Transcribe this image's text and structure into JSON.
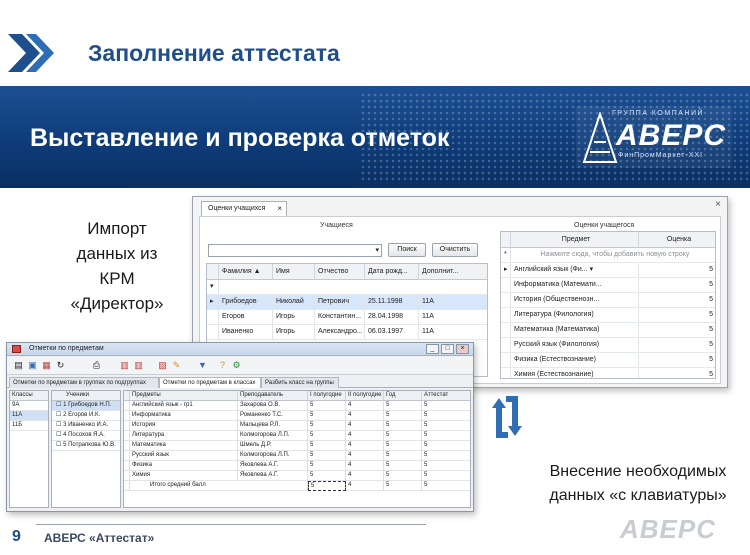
{
  "slide": {
    "title": "Заполнение аттестата",
    "banner_title": "Выставление и проверка отметок",
    "logo": {
      "top": "ГРУППА КОМПАНИЙ",
      "name": "АВЕРС",
      "sub": "ФинПромМаркет-XXI"
    },
    "import_text": [
      "Импорт",
      "данных из",
      "КРМ",
      "«Директор»"
    ],
    "keyboard_text": [
      "Внесение необходимых",
      "данных  «с клавиатуры»"
    ],
    "page_number": "9",
    "footer_text": "АВЕРС «Аттестат»",
    "footer_logo": "АВЕРС"
  },
  "window1": {
    "tab_label": "Оценки учащихся",
    "students_group": "Учащиеся",
    "grades_group": "Оценки учащегося",
    "search_button": "Поиск",
    "clear_button": "Очистить",
    "students_columns": [
      "Фамилия",
      "Имя",
      "Отчество",
      "Дата рожд...",
      "Дополнит..."
    ],
    "students": [
      [
        "Грибоедов",
        "Николай",
        "Петрович",
        "25.11.1998",
        "11А"
      ],
      [
        "Егоров",
        "Игорь",
        "Константин...",
        "28.04.1998",
        "11А"
      ],
      [
        "Иваненко",
        "Игорь",
        "Александро...",
        "06.03.1997",
        "11А"
      ]
    ],
    "grades_columns": [
      "Предмет",
      "Оценка"
    ],
    "new_row_hint": "Нажмите сюда, чтобы добавить новую строку",
    "grades": [
      [
        "Английский язык (Фи...",
        "5"
      ],
      [
        "Информатика (Математи...",
        "5"
      ],
      [
        "История (Общественозн...",
        "5"
      ],
      [
        "Литература (Филология)",
        "5"
      ],
      [
        "Математика (Математика)",
        "5"
      ],
      [
        "Русский язык (Филология)",
        "5"
      ],
      [
        "Физика (Естествознание)",
        "5"
      ],
      [
        "Химия (Естествознание)",
        "5"
      ]
    ]
  },
  "window2": {
    "title": "Отметки по предметам",
    "tabs": [
      "Отметки по предметам в группах по подгруппах",
      "Отметки по предметам в классах",
      "Разбить класс на группы"
    ],
    "classes_header": "Классы",
    "classes": [
      "9А",
      "11А",
      "11Б"
    ],
    "students_header": "Ученики",
    "students": [
      "1 Грибоедов Н.П.",
      "2 Егоров И.К.",
      "3 Иваненко И.А.",
      "4 Посохов Я.А.",
      "5 Потрапкова Ю.В."
    ],
    "columns": [
      "Предметы",
      "Преподаватель",
      "I полугодие",
      "II полугодие",
      "Год",
      "Аттестат"
    ],
    "rows": [
      [
        "Английский язык - гр1",
        "Захарова О.В.",
        "5",
        "4",
        "5",
        "5"
      ],
      [
        "Информатика",
        "Романенко Т.С.",
        "5",
        "4",
        "5",
        "5"
      ],
      [
        "История",
        "Мальцева Р.Л.",
        "5",
        "4",
        "5",
        "5"
      ],
      [
        "Литература",
        "Колмогорова Л.П.",
        "5",
        "4",
        "5",
        "5"
      ],
      [
        "Математика",
        "Шмель Д.Р.",
        "5",
        "4",
        "5",
        "5"
      ],
      [
        "Русский язык",
        "Колмогорова Л.П.",
        "5",
        "4",
        "5",
        "5"
      ],
      [
        "Физика",
        "Яковлева А.Г.",
        "5",
        "4",
        "5",
        "5"
      ],
      [
        "Химия",
        "Яковлева А.Г.",
        "5",
        "4",
        "5",
        "5"
      ]
    ],
    "summary_label": "Итого средний балл",
    "summary": [
      "5",
      "4",
      "5",
      "5"
    ]
  },
  "colors": {
    "accent": "#1f4e8c",
    "banner": "#0e3c79",
    "selection": "#d6e6fb"
  }
}
